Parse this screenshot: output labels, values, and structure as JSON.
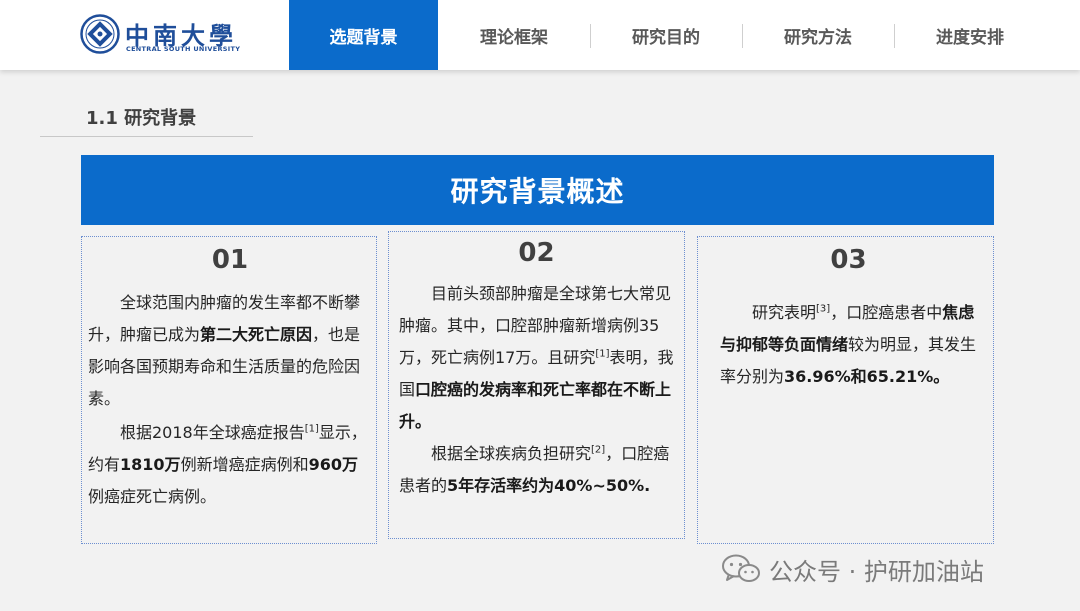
{
  "header": {
    "logo": {
      "name_cn": "中南大學",
      "name_en": "CENTRAL SOUTH UNIVERSITY",
      "icon": "csu-emblem-icon"
    },
    "nav": [
      {
        "label": "选题背景",
        "active": true
      },
      {
        "label": "理论框架",
        "active": false
      },
      {
        "label": "研究目的",
        "active": false
      },
      {
        "label": "研究方法",
        "active": false
      },
      {
        "label": "进度安排",
        "active": false
      }
    ]
  },
  "section": {
    "title": "1.1 研究背景"
  },
  "banner": {
    "title": "研究背景概述"
  },
  "cards": [
    {
      "num": "01",
      "p1": {
        "a": "全球范围内肿瘤的发生率都不断攀升，肿瘤已成为",
        "b": "第二大死亡原因",
        "c": "，也是影响各国预期寿命和生活质量的危险因素。"
      },
      "p2": {
        "a": "根据2018年全球癌症报告",
        "ref": "[1]",
        "b": "显示，约有",
        "c": "1810万",
        "d": "例新增癌症病例和",
        "e": "960万",
        "f": "例癌症死亡病例。"
      }
    },
    {
      "num": "02",
      "p1": {
        "a": "目前头颈部肿瘤是全球第七大常见肿瘤。其中，口腔部肿瘤新增病例35万，死亡病例17万。且研究",
        "ref": "[1]",
        "b": "表明，我国",
        "c": "口腔癌的发病率和死亡率都在不断上升。"
      },
      "p2": {
        "a": "根据全球疾病负担研究",
        "ref": "[2]",
        "b": "，口腔癌患者的",
        "c": "5年存活率约为40%~50%."
      }
    },
    {
      "num": "03",
      "p1": {
        "a": "研究表明",
        "ref": "[3]",
        "b": "，口腔癌患者中",
        "c": "焦虑与抑郁等负面情绪",
        "d": "较为明显，其发生率分别为",
        "e": "36.96%和65.21%。"
      }
    }
  ],
  "watermark": {
    "text": "公众号 · 护研加油站",
    "icon": "wechat-icon"
  },
  "colors": {
    "accent": "#0b6bcb",
    "background": "#f2f2f2",
    "logo": "#1f4e9a",
    "card_border": "#6d8fd0"
  }
}
